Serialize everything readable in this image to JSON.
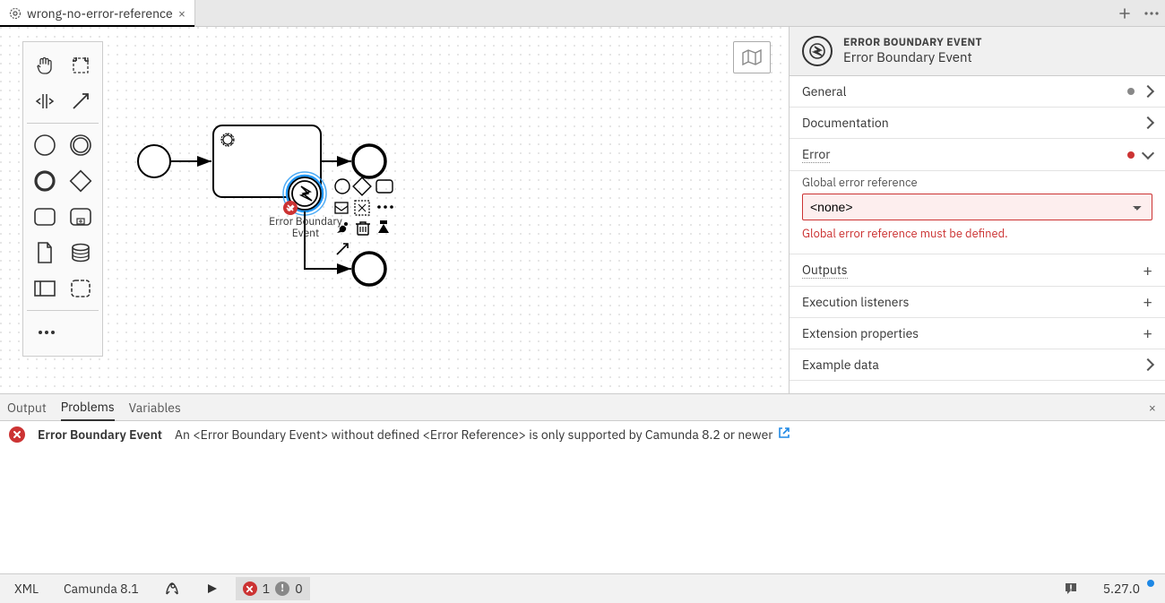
{
  "tabs": {
    "items": [
      {
        "label": "wrong-no-error-reference"
      }
    ]
  },
  "diagram": {
    "selected_element_label": "Error Boundary Event",
    "selected_line1": "Error Boundary",
    "selected_line2": "Event"
  },
  "properties": {
    "type_label": "ERROR BOUNDARY EVENT",
    "name": "Error Boundary Event",
    "sections": {
      "general": "General",
      "documentation": "Documentation",
      "error": "Error",
      "outputs": "Outputs",
      "execution_listeners": "Execution listeners",
      "extension_properties": "Extension properties",
      "example_data": "Example data"
    },
    "error": {
      "field_label": "Global error reference",
      "value": "<none>",
      "error_msg": "Global error reference must be defined."
    }
  },
  "bottom_tabs": {
    "output": "Output",
    "problems": "Problems",
    "variables": "Variables"
  },
  "problems": {
    "items": [
      {
        "element": "Error Boundary Event",
        "message": "An <Error Boundary Event> without defined <Error Reference> is only supported by Camunda 8.2 or newer"
      }
    ]
  },
  "status": {
    "xml": "XML",
    "engine": "Camunda 8.1",
    "errors": "1",
    "warnings": "0",
    "version": "5.27.0"
  }
}
